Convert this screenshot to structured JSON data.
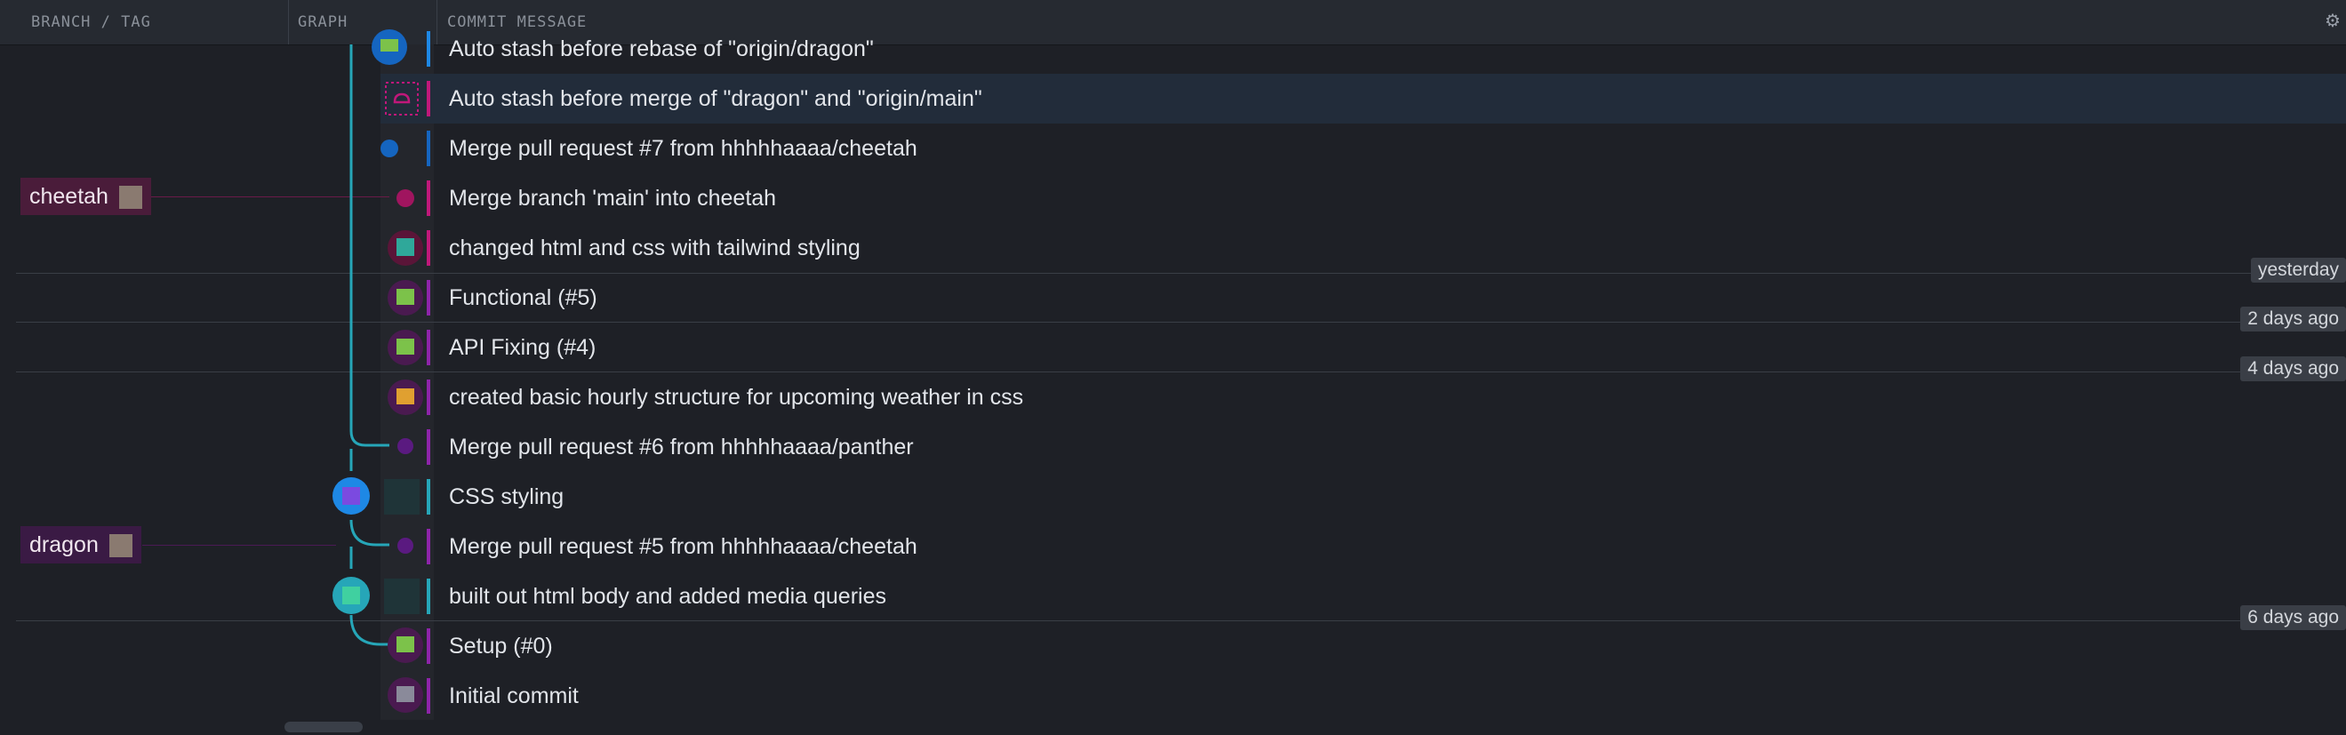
{
  "header": {
    "branch_tag": "BRANCH / TAG",
    "graph": "GRAPH",
    "commit_message": "COMMIT MESSAGE"
  },
  "branches": [
    {
      "name": "cheetah",
      "color": "#4a1c3a"
    },
    {
      "name": "dragon",
      "color": "#3a1a44"
    }
  ],
  "commits": [
    {
      "message": "Auto stash before rebase of \"origin/dragon\"",
      "lane_color": "#1e88e5"
    },
    {
      "message": "Auto stash before merge of \"dragon\" and \"origin/main\"",
      "lane_color": "#c0187a",
      "selected": true
    },
    {
      "message": "Merge pull request #7 from hhhhhaaaa/cheetah",
      "lane_color": "#1565c0"
    },
    {
      "message": "Merge branch 'main' into cheetah",
      "lane_color": "#c0187a"
    },
    {
      "message": "changed html and css with tailwind styling",
      "lane_color": "#c0187a"
    },
    {
      "message": "Functional (#5)",
      "lane_color": "#8e24aa"
    },
    {
      "message": "API Fixing (#4)",
      "lane_color": "#8e24aa"
    },
    {
      "message": "created basic hourly structure for upcoming weather in css",
      "lane_color": "#8e24aa"
    },
    {
      "message": "Merge pull request #6 from hhhhhaaaa/panther",
      "lane_color": "#8e24aa"
    },
    {
      "message": "CSS styling",
      "lane_color": "#26a6b8"
    },
    {
      "message": "Merge pull request #5 from hhhhhaaaa/cheetah",
      "lane_color": "#8e24aa"
    },
    {
      "message": "built out html body and added media queries",
      "lane_color": "#26a6b8"
    },
    {
      "message": "Setup (#0)",
      "lane_color": "#8e24aa"
    },
    {
      "message": "Initial commit",
      "lane_color": "#8e24aa"
    }
  ],
  "dates": [
    "yesterday",
    "2 days ago",
    "4 days ago",
    "6 days ago"
  ],
  "icons": {
    "settings": "gear-icon"
  }
}
